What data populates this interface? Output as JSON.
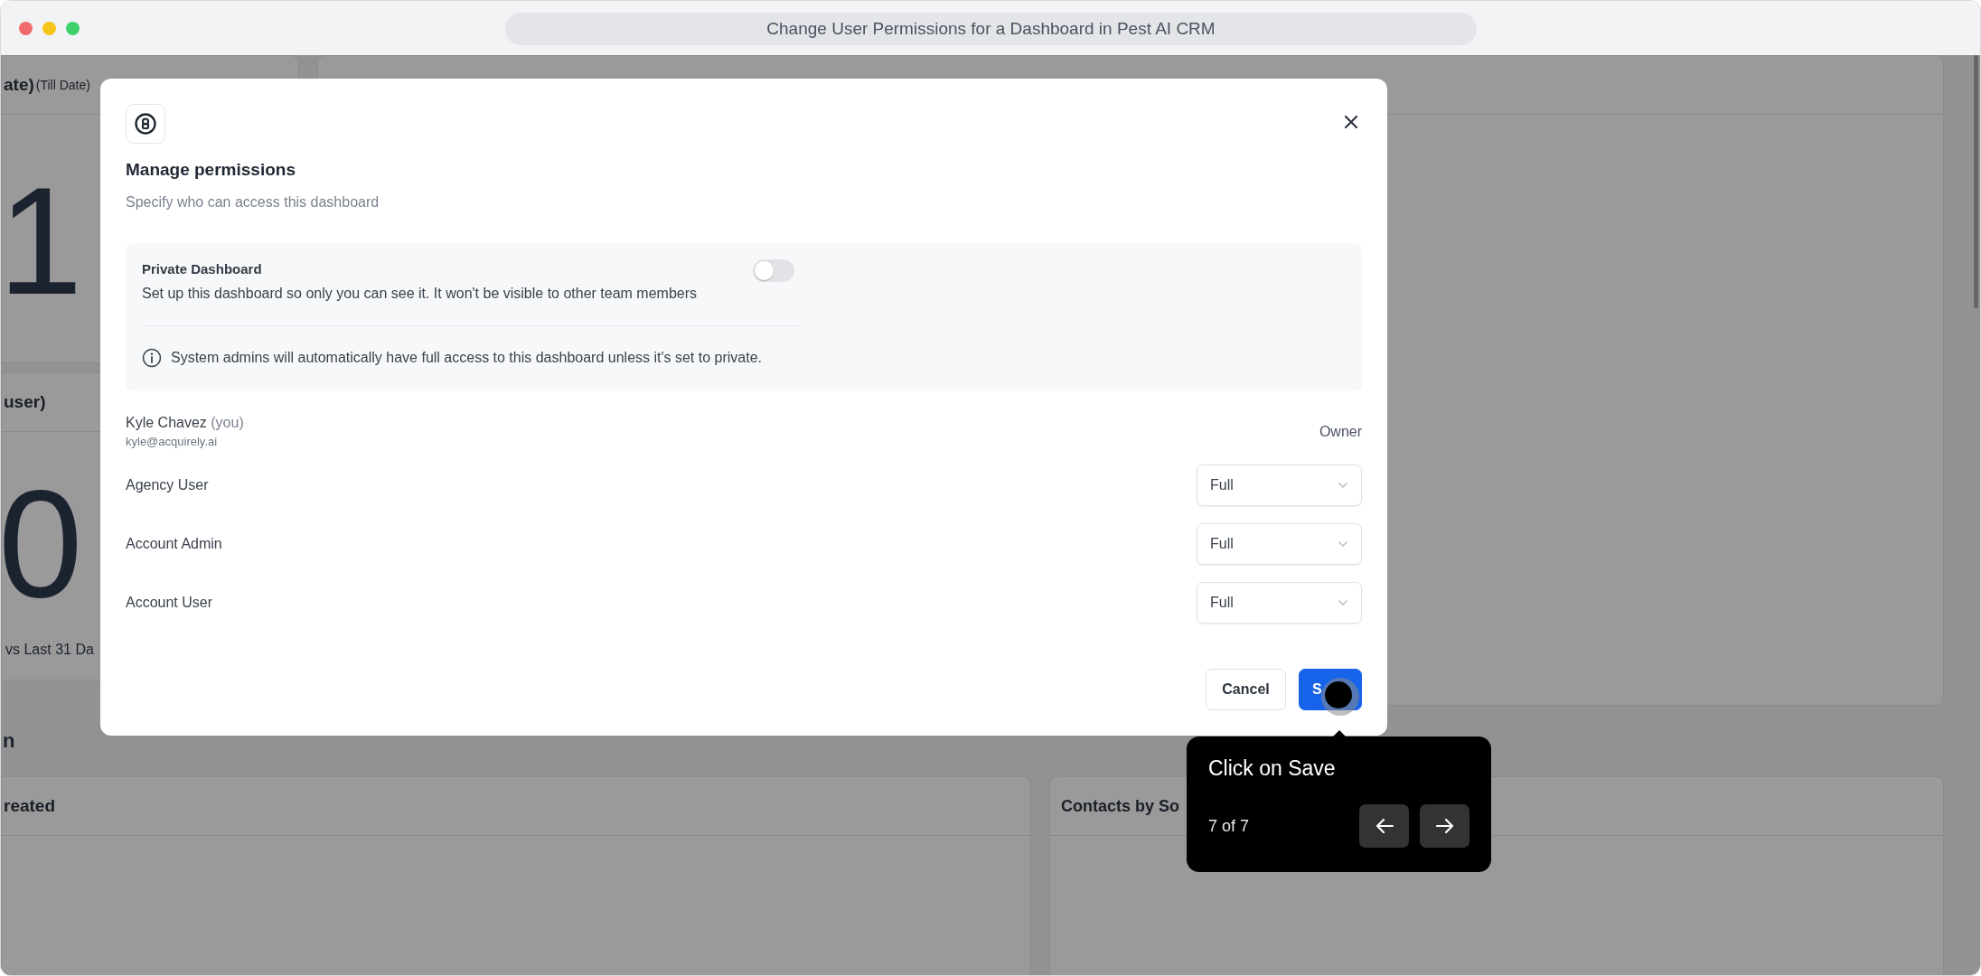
{
  "window": {
    "title": "Change User Permissions for a Dashboard in Pest AI CRM"
  },
  "dashboard": {
    "card_1": {
      "title": "ate)",
      "note": "(Till Date)",
      "value": "1"
    },
    "card_2": {
      "title": "user)",
      "value": "0",
      "comparison": "vs Last 31 Da"
    },
    "section_title": "n",
    "card_3": {
      "title": "reated"
    },
    "card_4": {
      "title": "Contacts by So"
    }
  },
  "modal": {
    "title": "Manage permissions",
    "subtitle": "Specify who can access this dashboard",
    "private": {
      "label": "Private Dashboard",
      "description": "Set up this dashboard so only you can see it. It won't be visible to other team members",
      "on": false,
      "info": "System admins will automatically have full access to this dashboard unless it's set to private."
    },
    "owner": {
      "name": "Kyle Chavez",
      "suffix": "(you)",
      "email": "kyle@acquirely.ai",
      "role": "Owner"
    },
    "roles": [
      {
        "name": "Agency User",
        "access": "Full"
      },
      {
        "name": "Account Admin",
        "access": "Full"
      },
      {
        "name": "Account User",
        "access": "Full"
      }
    ],
    "buttons": {
      "cancel": "Cancel",
      "save": "S"
    }
  },
  "tooltip": {
    "text": "Click on Save",
    "step": "7 of 7"
  }
}
